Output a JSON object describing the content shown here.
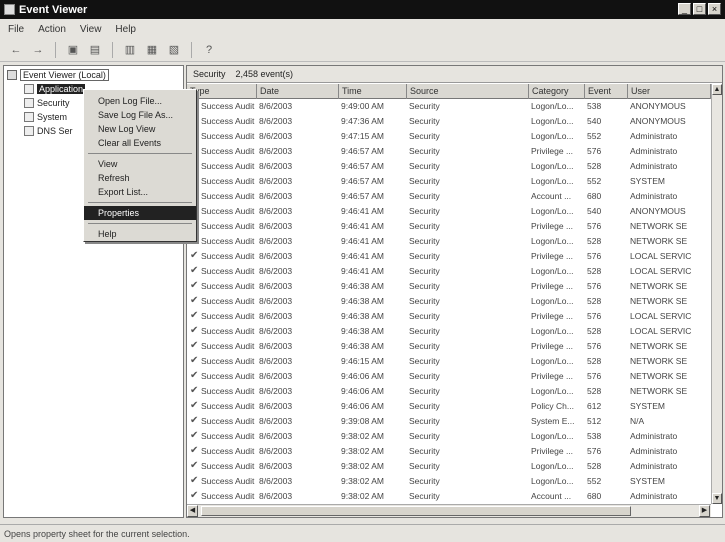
{
  "window": {
    "title": "Event Viewer",
    "controls": [
      "_",
      "□",
      "×"
    ]
  },
  "menubar": [
    "File",
    "Action",
    "View",
    "Help"
  ],
  "toolbar": {
    "icons": [
      "back-arrow-icon",
      "forward-arrow-icon",
      "up-folder-icon",
      "show-tree-icon",
      "properties-icon",
      "refresh-icon",
      "export-icon",
      "help-icon"
    ],
    "glyphs": [
      "←",
      "→",
      "▣",
      "▤",
      "▥",
      "▦",
      "▧",
      "?"
    ]
  },
  "tree": {
    "root": "Event Viewer (Local)",
    "items": [
      {
        "label": "Application",
        "selected": true
      },
      {
        "label": "Security",
        "selected": false
      },
      {
        "label": "System",
        "selected": false
      },
      {
        "label": "DNS Ser",
        "selected": false
      }
    ]
  },
  "context_menu": [
    {
      "label": "Open Log File...",
      "highlight": false
    },
    {
      "label": "Save Log File As...",
      "highlight": false
    },
    {
      "label": "New Log View",
      "highlight": false
    },
    {
      "label": "Clear all Events",
      "highlight": false
    },
    {
      "sep": true
    },
    {
      "label": "View",
      "highlight": false
    },
    {
      "label": "Refresh",
      "highlight": false
    },
    {
      "label": "Export List...",
      "highlight": false
    },
    {
      "sep": true
    },
    {
      "label": "Properties",
      "highlight": true
    },
    {
      "sep": true
    },
    {
      "label": "Help",
      "highlight": false
    }
  ],
  "info": {
    "log_name": "Security",
    "event_count": "2,458 event(s)"
  },
  "columns": [
    "Type",
    "Date",
    "Time",
    "Source",
    "Category",
    "Event",
    "User"
  ],
  "rows": [
    [
      "Success Audit",
      "8/6/2003",
      "9:49:00 AM",
      "Security",
      "Logon/Lo...",
      "538",
      "ANONYMOUS"
    ],
    [
      "Success Audit",
      "8/6/2003",
      "9:47:36 AM",
      "Security",
      "Logon/Lo...",
      "540",
      "ANONYMOUS"
    ],
    [
      "Success Audit",
      "8/6/2003",
      "9:47:15 AM",
      "Security",
      "Logon/Lo...",
      "552",
      "Administrato"
    ],
    [
      "Success Audit",
      "8/6/2003",
      "9:46:57 AM",
      "Security",
      "Privilege ...",
      "576",
      "Administrato"
    ],
    [
      "Success Audit",
      "8/6/2003",
      "9:46:57 AM",
      "Security",
      "Logon/Lo...",
      "528",
      "Administrato"
    ],
    [
      "Success Audit",
      "8/6/2003",
      "9:46:57 AM",
      "Security",
      "Logon/Lo...",
      "552",
      "SYSTEM"
    ],
    [
      "Success Audit",
      "8/6/2003",
      "9:46:57 AM",
      "Security",
      "Account ...",
      "680",
      "Administrato"
    ],
    [
      "Success Audit",
      "8/6/2003",
      "9:46:41 AM",
      "Security",
      "Logon/Lo...",
      "540",
      "ANONYMOUS"
    ],
    [
      "Success Audit",
      "8/6/2003",
      "9:46:41 AM",
      "Security",
      "Privilege ...",
      "576",
      "NETWORK SE"
    ],
    [
      "Success Audit",
      "8/6/2003",
      "9:46:41 AM",
      "Security",
      "Logon/Lo...",
      "528",
      "NETWORK SE"
    ],
    [
      "Success Audit",
      "8/6/2003",
      "9:46:41 AM",
      "Security",
      "Privilege ...",
      "576",
      "LOCAL SERVIC"
    ],
    [
      "Success Audit",
      "8/6/2003",
      "9:46:41 AM",
      "Security",
      "Logon/Lo...",
      "528",
      "LOCAL SERVIC"
    ],
    [
      "Success Audit",
      "8/6/2003",
      "9:46:38 AM",
      "Security",
      "Privilege ...",
      "576",
      "NETWORK SE"
    ],
    [
      "Success Audit",
      "8/6/2003",
      "9:46:38 AM",
      "Security",
      "Logon/Lo...",
      "528",
      "NETWORK SE"
    ],
    [
      "Success Audit",
      "8/6/2003",
      "9:46:38 AM",
      "Security",
      "Privilege ...",
      "576",
      "LOCAL SERVIC"
    ],
    [
      "Success Audit",
      "8/6/2003",
      "9:46:38 AM",
      "Security",
      "Logon/Lo...",
      "528",
      "LOCAL SERVIC"
    ],
    [
      "Success Audit",
      "8/6/2003",
      "9:46:38 AM",
      "Security",
      "Privilege ...",
      "576",
      "NETWORK SE"
    ],
    [
      "Success Audit",
      "8/6/2003",
      "9:46:15 AM",
      "Security",
      "Logon/Lo...",
      "528",
      "NETWORK SE"
    ],
    [
      "Success Audit",
      "8/6/2003",
      "9:46:06 AM",
      "Security",
      "Privilege ...",
      "576",
      "NETWORK SE"
    ],
    [
      "Success Audit",
      "8/6/2003",
      "9:46:06 AM",
      "Security",
      "Logon/Lo...",
      "528",
      "NETWORK SE"
    ],
    [
      "Success Audit",
      "8/6/2003",
      "9:46:06 AM",
      "Security",
      "Policy Ch...",
      "612",
      "SYSTEM"
    ],
    [
      "Success Audit",
      "8/6/2003",
      "9:39:08 AM",
      "Security",
      "System E...",
      "512",
      "N/A"
    ],
    [
      "Success Audit",
      "8/6/2003",
      "9:38:02 AM",
      "Security",
      "Logon/Lo...",
      "538",
      "Administrato"
    ],
    [
      "Success Audit",
      "8/6/2003",
      "9:38:02 AM",
      "Security",
      "Privilege ...",
      "576",
      "Administrato"
    ],
    [
      "Success Audit",
      "8/6/2003",
      "9:38:02 AM",
      "Security",
      "Logon/Lo...",
      "528",
      "Administrato"
    ],
    [
      "Success Audit",
      "8/6/2003",
      "9:38:02 AM",
      "Security",
      "Logon/Lo...",
      "552",
      "SYSTEM"
    ],
    [
      "Success Audit",
      "8/6/2003",
      "9:38:02 AM",
      "Security",
      "Account ...",
      "680",
      "Administrato"
    ]
  ],
  "statusbar": "Opens property sheet for the current selection."
}
